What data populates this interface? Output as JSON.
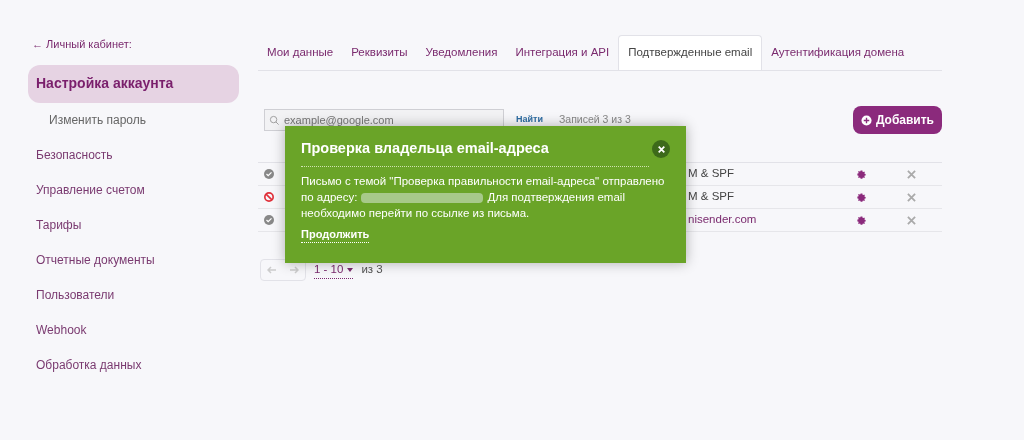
{
  "sidebar": {
    "back": "← Личный кабинет:",
    "items": [
      {
        "label": "Настройка аккаунта",
        "selected": true,
        "kind": "main"
      },
      {
        "label": "Изменить пароль",
        "selected": false,
        "kind": "sub"
      },
      {
        "label": "Безопасность",
        "selected": false,
        "kind": "main"
      },
      {
        "label": "Управление счетом",
        "selected": false,
        "kind": "main"
      },
      {
        "label": "Тарифы",
        "selected": false,
        "kind": "main"
      },
      {
        "label": "Отчетные документы",
        "selected": false,
        "kind": "main"
      },
      {
        "label": "Пользователи",
        "selected": false,
        "kind": "main"
      },
      {
        "label": "Webhook",
        "selected": false,
        "kind": "main"
      },
      {
        "label": "Обработка данных",
        "selected": false,
        "kind": "main"
      }
    ]
  },
  "tabs": [
    {
      "label": "Мои данные",
      "selected": false
    },
    {
      "label": "Реквизиты",
      "selected": false
    },
    {
      "label": "Уведомления",
      "selected": false
    },
    {
      "label": "Интеграция и API",
      "selected": false
    },
    {
      "label": "Подтвержденные email",
      "selected": true
    },
    {
      "label": "Аутентификация домена",
      "selected": false
    }
  ],
  "search": {
    "placeholder": "example@google.com",
    "button": "Найти",
    "count": "Записей 3 из 3"
  },
  "add_button": "Добавить",
  "table": {
    "rows": [
      {
        "verified": true,
        "domain": "M & SPF",
        "kind": "action"
      },
      {
        "verified": false,
        "domain": "M & SPF",
        "kind": "action"
      },
      {
        "verified": true,
        "domain": "nisender.com",
        "kind": "domain"
      }
    ]
  },
  "pagination": {
    "range": "1 - 10",
    "total": "из 3"
  },
  "popup": {
    "title": "Проверка владельца email-адреса",
    "text_before": "Письмо с темой \"Проверка правильности email-адреса\" отправлено по адресу:",
    "text_after": "Для подтверждения email необходимо перейти по ссылке из письма.",
    "link": "Продолжить"
  }
}
